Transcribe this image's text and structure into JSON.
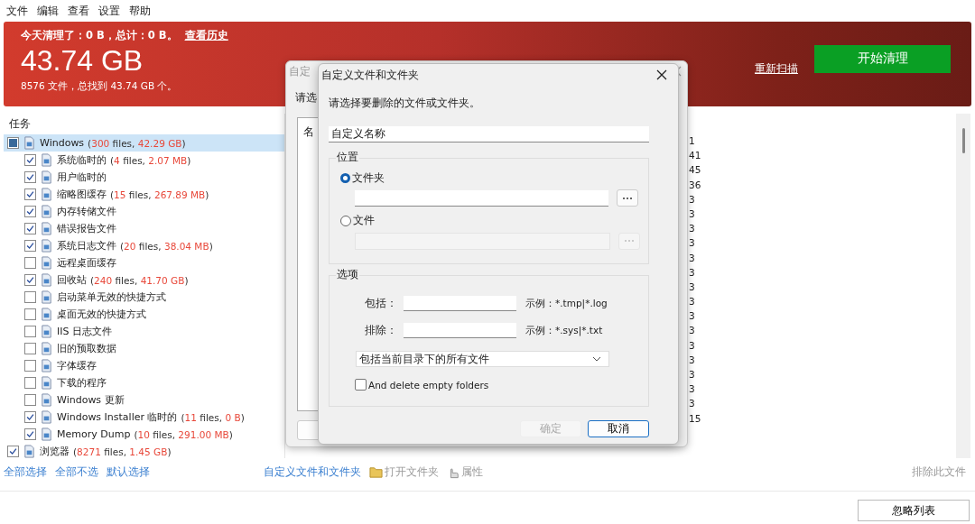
{
  "menu": [
    "文件",
    "编辑",
    "查看",
    "设置",
    "帮助"
  ],
  "header": {
    "summary": "今天清理了：0 B，总计：0 B。",
    "history_link": "查看历史",
    "total": "43.74 GB",
    "detail": "8576 文件，总找到 43.74 GB 个。",
    "rescan_link": "重新扫描",
    "start_button": "开始清理"
  },
  "tasks": {
    "heading": "任务",
    "items": [
      {
        "label": "Windows",
        "count": [
          "(",
          "300",
          " files, ",
          "42.29 GB",
          ")"
        ],
        "checked": true,
        "partial": true,
        "selected": true,
        "children": [
          {
            "label": "系统临时的",
            "count": [
              "(",
              "4",
              " files, ",
              "2.07 MB",
              ")"
            ],
            "checked": true
          },
          {
            "label": "用户临时的",
            "checked": true
          },
          {
            "label": "缩略图缓存",
            "count": [
              "(",
              "15",
              " files, ",
              "267.89 MB",
              ")"
            ],
            "checked": true
          },
          {
            "label": "内存转储文件",
            "checked": true
          },
          {
            "label": "错误报告文件",
            "checked": true
          },
          {
            "label": "系统日志文件",
            "count": [
              "(",
              "20",
              " files, ",
              "38.04 MB",
              ")"
            ],
            "checked": true
          },
          {
            "label": "远程桌面缓存",
            "checked": false
          },
          {
            "label": "回收站",
            "count": [
              "(",
              "240",
              " files, ",
              "41.70 GB",
              ")"
            ],
            "checked": true
          },
          {
            "label": "启动菜单无效的快捷方式",
            "checked": false
          },
          {
            "label": "桌面无效的快捷方式",
            "checked": false
          },
          {
            "label": "IIS 日志文件",
            "checked": false
          },
          {
            "label": "旧的预取数据",
            "checked": false
          },
          {
            "label": "字体缓存",
            "checked": false
          },
          {
            "label": "下载的程序",
            "checked": false
          },
          {
            "label": "Windows 更新",
            "checked": false
          },
          {
            "label": "Windows Installer 临时的",
            "count": [
              "(",
              "11",
              " files, ",
              "0 B",
              ")"
            ],
            "checked": true
          },
          {
            "label": "Memory Dump",
            "count": [
              "(",
              "10",
              " files, ",
              "291.00 MB",
              ")"
            ],
            "checked": true
          }
        ]
      },
      {
        "label": "浏览器",
        "count": [
          "(",
          "8271",
          " files, ",
          "1.45 GB",
          ")"
        ],
        "checked": true,
        "selected": false
      }
    ]
  },
  "list": {
    "column_fragments": [
      "1",
      "41",
      "45",
      "36",
      "3",
      "3",
      "3",
      "3",
      "3",
      "3",
      "3",
      "3",
      "3",
      "3",
      "3",
      "3",
      "3",
      "3",
      "3",
      "15"
    ]
  },
  "select_links": [
    "全部选择",
    "全部不选",
    "默认选择"
  ],
  "actions": [
    {
      "label": "自定义文件和文件夹",
      "kind": "link",
      "disabled": false
    },
    {
      "label": "打开文件夹",
      "kind": "folder",
      "disabled": true
    },
    {
      "label": "属性",
      "kind": "properties",
      "disabled": true
    }
  ],
  "exclude_link": {
    "label": "排除此文件",
    "disabled": true
  },
  "ignore_button": "忽略列表",
  "back_dialog": {
    "title": "自定",
    "prompt": "请选",
    "list_heading": "名"
  },
  "dialog": {
    "title": "自定义文件和文件夹",
    "prompt": "请选择要删除的文件或文件夹。",
    "name_value": "自定义名称",
    "location_title": "位置",
    "locations": [
      {
        "label": "文件夹",
        "selected": true
      },
      {
        "label": "文件",
        "selected": false
      }
    ],
    "options_title": "选项",
    "filters": [
      {
        "label": "包括：",
        "example": "示例：*.tmp|*.log"
      },
      {
        "label": "排除：",
        "example": "示例：*.sys|*.txt"
      }
    ],
    "scope": "包括当前目录下的所有文件",
    "delete_empty": {
      "label": "And delete empty folders",
      "checked": false
    },
    "buttons": [
      {
        "label": "确定",
        "disabled": true,
        "default": false
      },
      {
        "label": "取消",
        "disabled": false,
        "default": true
      }
    ]
  }
}
